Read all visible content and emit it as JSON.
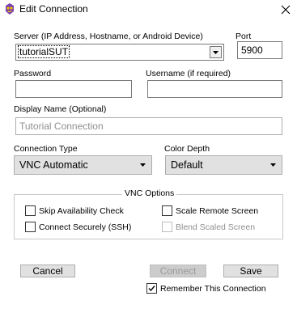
{
  "window": {
    "title": "Edit Connection",
    "icon": "app-icon",
    "close_icon": "close-icon"
  },
  "server": {
    "label": "Server (IP Address, Hostname, or Android Device)",
    "value": "tutorialSUT"
  },
  "port": {
    "label": "Port",
    "value": "5900"
  },
  "password": {
    "label": "Password",
    "value": ""
  },
  "username": {
    "label": "Username (if required)",
    "value": ""
  },
  "display_name": {
    "label": "Display Name (Optional)",
    "placeholder": "Tutorial Connection"
  },
  "connection_type": {
    "label": "Connection Type",
    "selected": "VNC Automatic"
  },
  "color_depth": {
    "label": "Color Depth",
    "selected": "Default"
  },
  "vnc_options": {
    "title": "VNC Options",
    "skip_availability": {
      "label": "Skip Availability Check",
      "checked": false
    },
    "scale_remote": {
      "label": "Scale Remote Screen",
      "checked": false
    },
    "connect_securely": {
      "label": "Connect Securely (SSH)",
      "checked": false
    },
    "blend_scaled": {
      "label": "Blend Scaled Screen",
      "checked": false,
      "disabled": true
    }
  },
  "buttons": {
    "cancel": "Cancel",
    "connect": "Connect",
    "save": "Save"
  },
  "remember": {
    "label": "Remember This Connection",
    "checked": true
  },
  "colors": {
    "title_bg": "#ffffff",
    "button_bg": "#e1e1e1",
    "border": "#7a7a7a",
    "disabled_text": "#8f8f8f"
  }
}
